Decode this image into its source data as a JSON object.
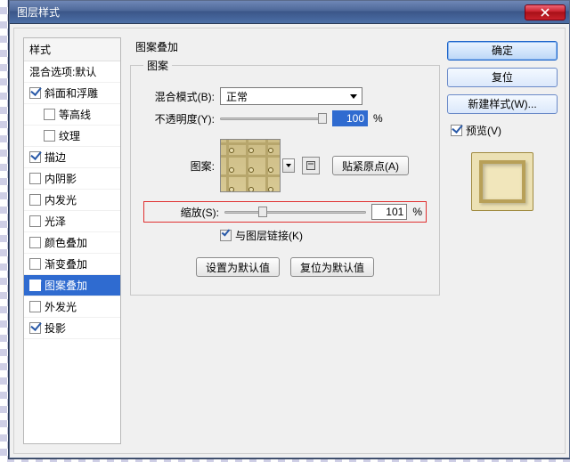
{
  "window": {
    "title": "图层样式"
  },
  "sidebar": {
    "header": "样式",
    "blend_defaults": "混合选项:默认",
    "items": [
      {
        "label": "斜面和浮雕",
        "checked": true,
        "indent": false
      },
      {
        "label": "等高线",
        "checked": false,
        "indent": true
      },
      {
        "label": "纹理",
        "checked": false,
        "indent": true
      },
      {
        "label": "描边",
        "checked": true,
        "indent": false
      },
      {
        "label": "内阴影",
        "checked": false,
        "indent": false
      },
      {
        "label": "内发光",
        "checked": false,
        "indent": false
      },
      {
        "label": "光泽",
        "checked": false,
        "indent": false
      },
      {
        "label": "颜色叠加",
        "checked": false,
        "indent": false
      },
      {
        "label": "渐变叠加",
        "checked": false,
        "indent": false
      },
      {
        "label": "图案叠加",
        "checked": true,
        "indent": false,
        "selected": true
      },
      {
        "label": "外发光",
        "checked": false,
        "indent": false
      },
      {
        "label": "投影",
        "checked": true,
        "indent": false
      }
    ]
  },
  "panel": {
    "title": "图案叠加",
    "group_legend": "图案",
    "blend_mode_label": "混合模式(B):",
    "blend_mode_value": "正常",
    "opacity_label": "不透明度(Y):",
    "opacity_value": "100",
    "opacity_unit": "%",
    "pattern_label": "图案:",
    "snap_origin_label": "贴紧原点(A)",
    "scale_label": "缩放(S):",
    "scale_value": "101",
    "scale_unit": "%",
    "link_layer_label": "与图层链接(K)",
    "link_layer_checked": true,
    "set_default_label": "设置为默认值",
    "reset_default_label": "复位为默认值"
  },
  "right": {
    "ok": "确定",
    "reset": "复位",
    "new_style": "新建样式(W)...",
    "preview_label": "预览(V)"
  }
}
